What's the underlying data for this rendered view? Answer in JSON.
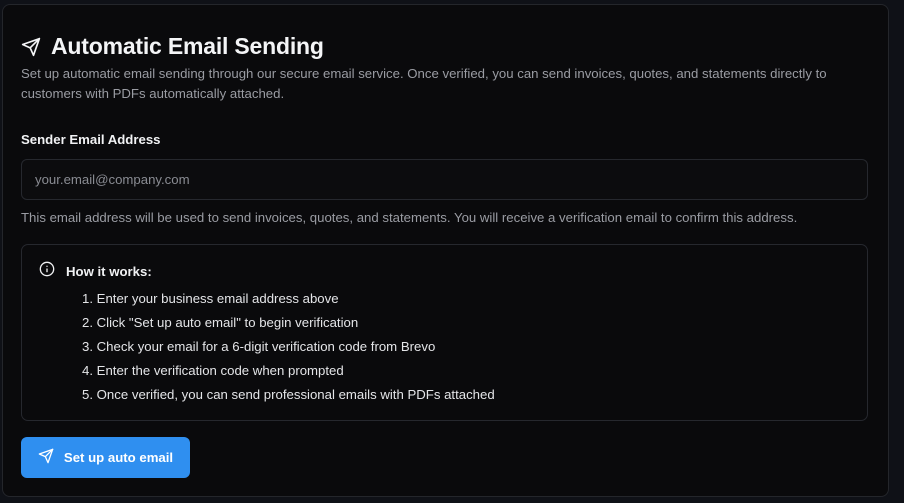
{
  "header": {
    "icon": "send-icon",
    "title": "Automatic Email Sending",
    "description": "Set up automatic email sending through our secure email service. Once verified, you can send invoices, quotes, and statements directly to customers with PDFs automatically attached."
  },
  "sender_email": {
    "label": "Sender Email Address",
    "placeholder": "your.email@company.com",
    "value": "",
    "helper": "This email address will be used to send invoices, quotes, and statements. You will receive a verification email to confirm this address."
  },
  "how_it_works": {
    "icon": "info-icon",
    "title": "How it works:",
    "steps": [
      "1. Enter your business email address above",
      "2. Click \"Set up auto email\" to begin verification",
      "3. Check your email for a 6-digit verification code from Brevo",
      "4. Enter the verification code when prompted",
      "5. Once verified, you can send professional emails with PDFs attached"
    ]
  },
  "action": {
    "icon": "send-icon",
    "label": "Set up auto email",
    "color": "#2f8ff0"
  }
}
